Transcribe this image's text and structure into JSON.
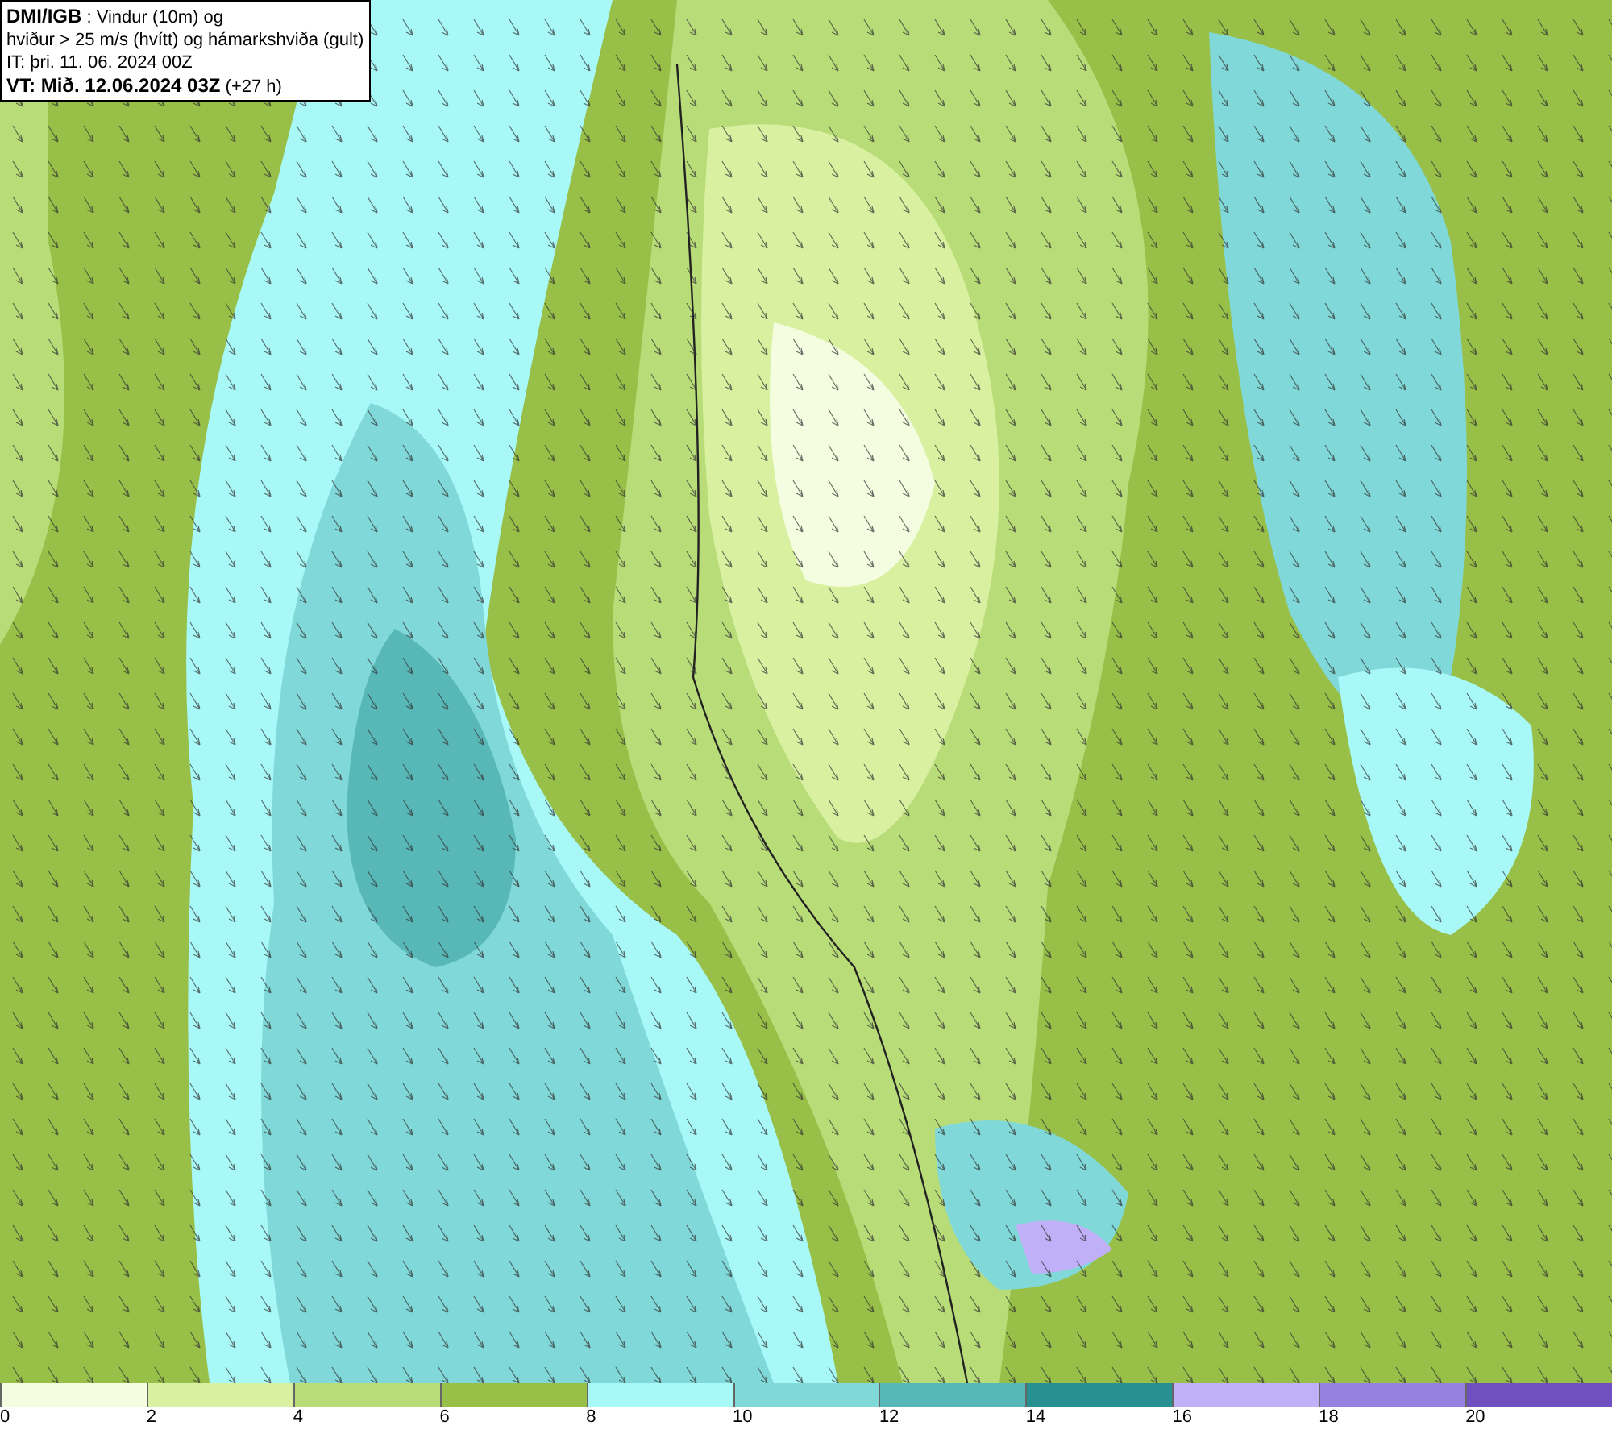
{
  "title_box": {
    "lines": [
      "**DMI/IGB** : Vindur (10m) og",
      "hviður > 25 m/s (hvítt) og hámarkshviða (gult)",
      "IT: þri. 11. 06. 2024 00Z",
      "**VT: Mið. 12.06.2024 03Z** (+27 h)"
    ]
  },
  "legend": [
    {
      "label": "0",
      "color": "#f5fde0"
    },
    {
      "label": "2",
      "color": "#d8f0a0"
    },
    {
      "label": "4",
      "color": "#b8dc78"
    },
    {
      "label": "6",
      "color": "#98c048"
    },
    {
      "label": "8",
      "color": "#a8f8f8"
    },
    {
      "label": "10",
      "color": "#80d8d8"
    },
    {
      "label": "12",
      "color": "#58b8b8"
    },
    {
      "label": "14",
      "color": "#289090"
    },
    {
      "label": "16",
      "color": "#c0b0f8"
    },
    {
      "label": "18",
      "color": "#9880e0"
    },
    {
      "label": "20",
      "color": "#7050c0"
    }
  ]
}
